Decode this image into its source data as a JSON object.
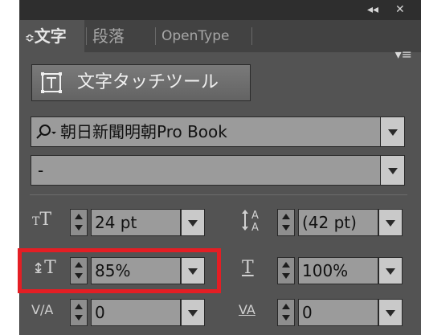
{
  "titlebar": {
    "collapse_glyph": "◂◂",
    "close_glyph": "✕"
  },
  "tabs": [
    {
      "label": "文字",
      "prefix": "≎",
      "active": true
    },
    {
      "label": "段落",
      "active": false
    },
    {
      "label": "OpenType",
      "active": false
    }
  ],
  "panel_menu_icon": "panel-menu-icon",
  "touch_tool": {
    "label": "文字タッチツール",
    "icon": "touch-type-tool-icon"
  },
  "font_family": {
    "value": "朝日新聞明朝Pro Book",
    "icon": "search-icon"
  },
  "font_style": {
    "value": "-"
  },
  "controls": {
    "font_size": {
      "value": "24 pt",
      "icon": "font-size-icon"
    },
    "leading": {
      "value": "(42 pt)",
      "icon": "leading-icon"
    },
    "vertical_scale": {
      "value": "85%",
      "icon": "vertical-scale-icon"
    },
    "horizontal_scale": {
      "value": "100%",
      "icon": "horizontal-scale-icon"
    },
    "kerning": {
      "value": "0",
      "icon": "kerning-icon"
    },
    "tracking": {
      "value": "0",
      "icon": "tracking-icon"
    }
  },
  "colors": {
    "highlight": "#e41e24",
    "panel": "#535353",
    "field": "#9b9b9b"
  }
}
